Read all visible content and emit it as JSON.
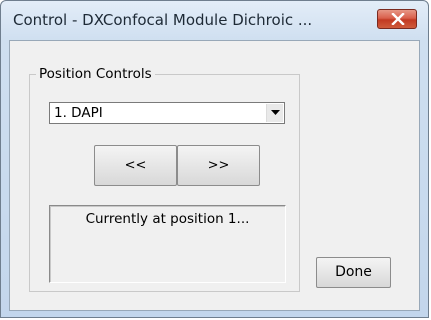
{
  "window": {
    "title": "Control - DXConfocal Module Dichroic ...",
    "close_icon": "close-icon",
    "accent_color": "#c8402a"
  },
  "position_controls": {
    "group_label": "Position Controls",
    "selected_position": "1. DAPI",
    "dropdown_icon": "chevron-down-icon",
    "prev_label": "<<",
    "next_label": ">>",
    "status_text": "Currently at position 1..."
  },
  "footer": {
    "done_label": "Done"
  }
}
